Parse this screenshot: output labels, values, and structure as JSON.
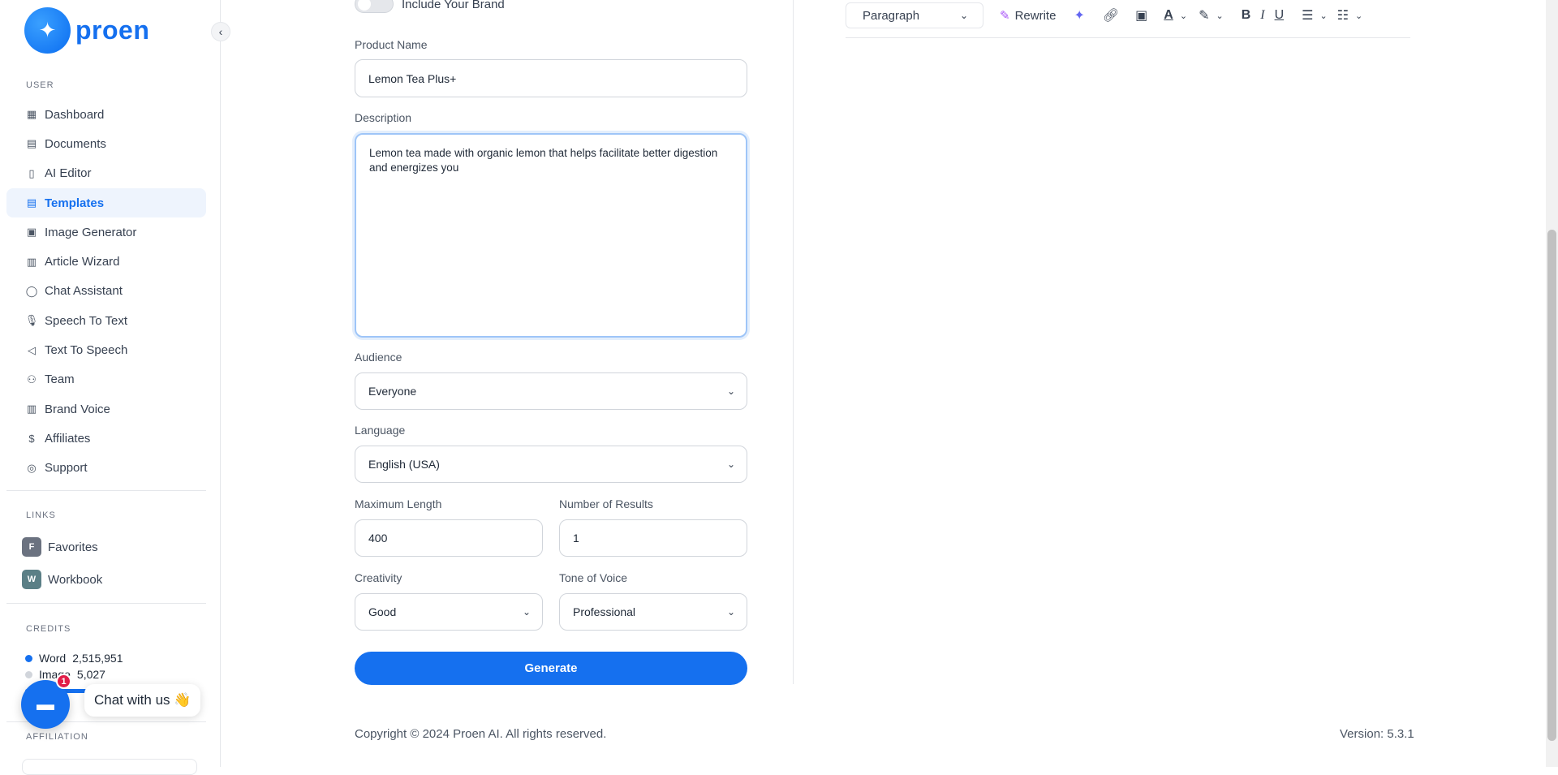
{
  "brand": {
    "name": "proen"
  },
  "sidebar": {
    "user_label": "USER",
    "items": [
      {
        "label": "Dashboard",
        "icon": "dashboard-icon"
      },
      {
        "label": "Documents",
        "icon": "documents-icon"
      },
      {
        "label": "AI Editor",
        "icon": "ai-editor-icon"
      },
      {
        "label": "Templates",
        "icon": "templates-icon"
      },
      {
        "label": "Image Generator",
        "icon": "image-icon"
      },
      {
        "label": "Article Wizard",
        "icon": "article-icon"
      },
      {
        "label": "Chat Assistant",
        "icon": "chat-icon"
      },
      {
        "label": "Speech To Text",
        "icon": "mic-icon"
      },
      {
        "label": "Text To Speech",
        "icon": "speaker-icon"
      },
      {
        "label": "Team",
        "icon": "team-icon"
      },
      {
        "label": "Brand Voice",
        "icon": "brand-voice-icon"
      },
      {
        "label": "Affiliates",
        "icon": "dollar-icon"
      },
      {
        "label": "Support",
        "icon": "support-icon"
      }
    ],
    "active_item": "Templates",
    "links_label": "LINKS",
    "links": [
      {
        "badge": "F",
        "label": "Favorites"
      },
      {
        "badge": "W",
        "label": "Workbook"
      }
    ],
    "credits_label": "CREDITS",
    "credits": {
      "word_label": "Word",
      "word_value": "2,515,951",
      "image_label": "Image",
      "image_value": "5,027"
    },
    "affiliation_label": "AFFILIATION"
  },
  "chat": {
    "badge": "1",
    "label": "Chat with us 👋"
  },
  "form": {
    "brand_toggle_label": "Include Your Brand",
    "product_name_label": "Product Name",
    "product_name_value": "Lemon Tea Plus+",
    "description_label": "Description",
    "description_value": "Lemon tea made with organic lemon that helps facilitate better digestion and energizes you",
    "audience_label": "Audience",
    "audience_value": "Everyone",
    "language_label": "Language",
    "language_value": "English (USA)",
    "max_length_label": "Maximum Length",
    "max_length_value": "400",
    "results_label": "Number of Results",
    "results_value": "1",
    "creativity_label": "Creativity",
    "creativity_value": "Good",
    "tone_label": "Tone of Voice",
    "tone_value": "Professional",
    "generate_label": "Generate"
  },
  "editor": {
    "paragraph_label": "Paragraph",
    "rewrite_label": "Rewrite"
  },
  "footer": {
    "copyright": "Copyright © 2024 Proen AI. All rights reserved.",
    "version": "Version: 5.3.1"
  },
  "colors": {
    "accent": "#1570ef",
    "active_bg": "#eef4fd",
    "badge_red": "#e11d48"
  }
}
